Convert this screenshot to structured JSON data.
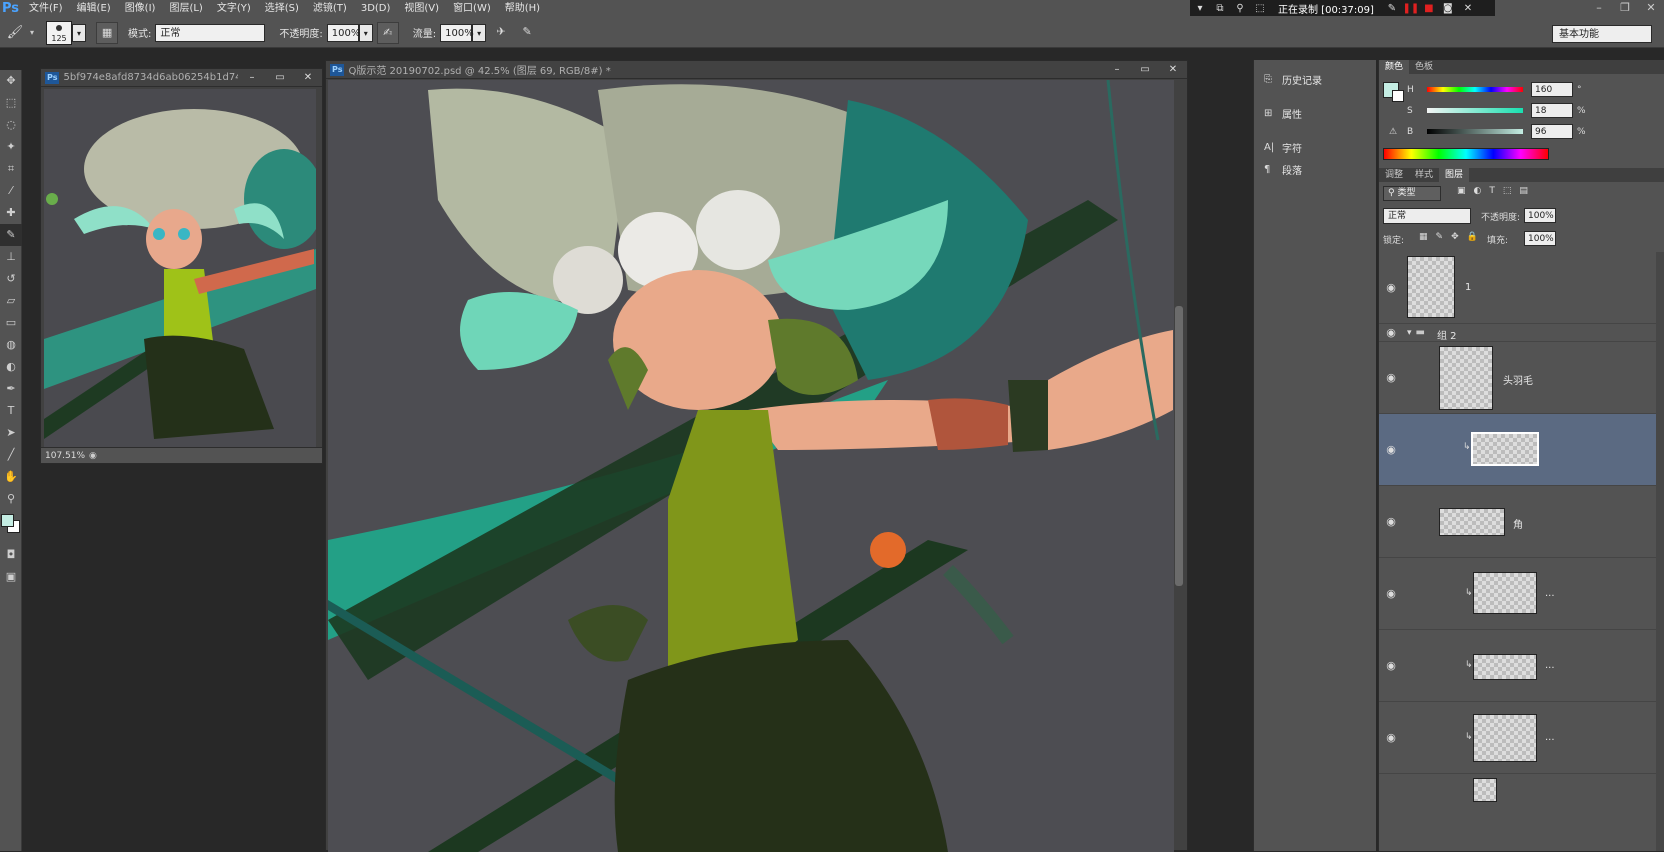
{
  "app": {
    "logo": "Ps"
  },
  "menu": [
    "文件(F)",
    "编辑(E)",
    "图像(I)",
    "图层(L)",
    "文字(Y)",
    "选择(S)",
    "滤镜(T)",
    "3D(D)",
    "视图(V)",
    "窗口(W)",
    "帮助(H)"
  ],
  "recording": {
    "label": "正在录制 [00:37:09]"
  },
  "options": {
    "brush_size": "125",
    "mode_label": "模式:",
    "mode_value": "正常",
    "opacity_label": "不透明度:",
    "opacity_value": "100%",
    "flow_label": "流量:",
    "flow_value": "100%",
    "workspace": "基本功能"
  },
  "documents": {
    "reference": {
      "title": "5bf974e8afd8734d6ab06254b1d74c9...",
      "zoom": "107.51%"
    },
    "main": {
      "title": "Q版示范 20190702.psd @ 42.5% (图层 69, RGB/8#) *"
    }
  },
  "panel_strip": [
    {
      "icon": "history-icon",
      "label": "历史记录"
    },
    {
      "icon": "properties-icon",
      "label": "属性"
    },
    {
      "icon": "character-icon",
      "label": "字符"
    },
    {
      "icon": "paragraph-icon",
      "label": "段落"
    }
  ],
  "color_panel": {
    "tabs": [
      "颜色",
      "色板"
    ],
    "h_label": "H",
    "h_value": "160",
    "h_unit": "°",
    "s_label": "S",
    "s_value": "18",
    "s_unit": "%",
    "b_label": "B",
    "b_value": "96",
    "b_unit": "%",
    "foreground": "#c4ede3"
  },
  "layers_panel": {
    "tabs": [
      "调整",
      "样式",
      "图层"
    ],
    "filter_label": "类型",
    "blend_mode": "正常",
    "opacity_label": "不透明度:",
    "opacity_value": "100%",
    "lock_label": "锁定:",
    "fill_label": "填充:",
    "fill_value": "100%",
    "layers": [
      {
        "name": "1"
      },
      {
        "name": "组 2"
      },
      {
        "name": "头羽毛"
      },
      {
        "name": ""
      },
      {
        "name": "角"
      },
      {
        "name": "..."
      },
      {
        "name": "..."
      },
      {
        "name": "..."
      }
    ]
  }
}
